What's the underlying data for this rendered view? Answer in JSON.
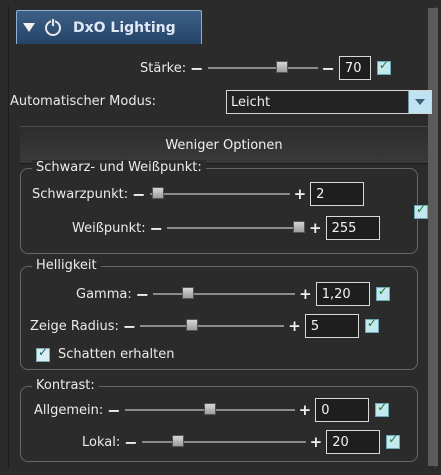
{
  "panel": {
    "tab_title": "DxO Lighting",
    "icons": [
      "collapse-arrow-icon",
      "power-icon"
    ]
  },
  "controls": {
    "starke": {
      "label": "Stärke:",
      "value": "70",
      "enabled": true,
      "slider_fraction": 0.7
    },
    "mode": {
      "label": "Automatischer Modus:",
      "selected": "Leicht"
    },
    "options_header": "Weniger Optionen"
  },
  "groups": {
    "black_white": {
      "title": "Schwarz- und Weißpunkt:",
      "black_point": {
        "label": "Schwarzpunkt:",
        "value": "2",
        "slider_fraction": 0.02
      },
      "white_point": {
        "label": "Weißpunkt:",
        "value": "255",
        "slider_fraction": 1.0
      }
    },
    "brightness": {
      "title": "Helligkeit",
      "gamma": {
        "label": "Gamma:",
        "value": "1,20",
        "slider_fraction": 0.22
      },
      "zeige_radius": {
        "label": "Zeige Radius:",
        "value": "5",
        "slider_fraction": 0.35
      },
      "keep_shadows": {
        "label": "Schatten erhalten",
        "checked": true
      }
    },
    "contrast": {
      "title": "Kontrast:",
      "general": {
        "label": "Allgemein:",
        "value": "0",
        "slider_fraction": 0.5
      },
      "local": {
        "label": "Lokal:",
        "value": "20",
        "slider_fraction": 0.2
      }
    }
  },
  "colors": {
    "tab_blue": "#2f5278",
    "check_bg": "#c3e8ef",
    "panel_bg": "#2b2b2b"
  }
}
